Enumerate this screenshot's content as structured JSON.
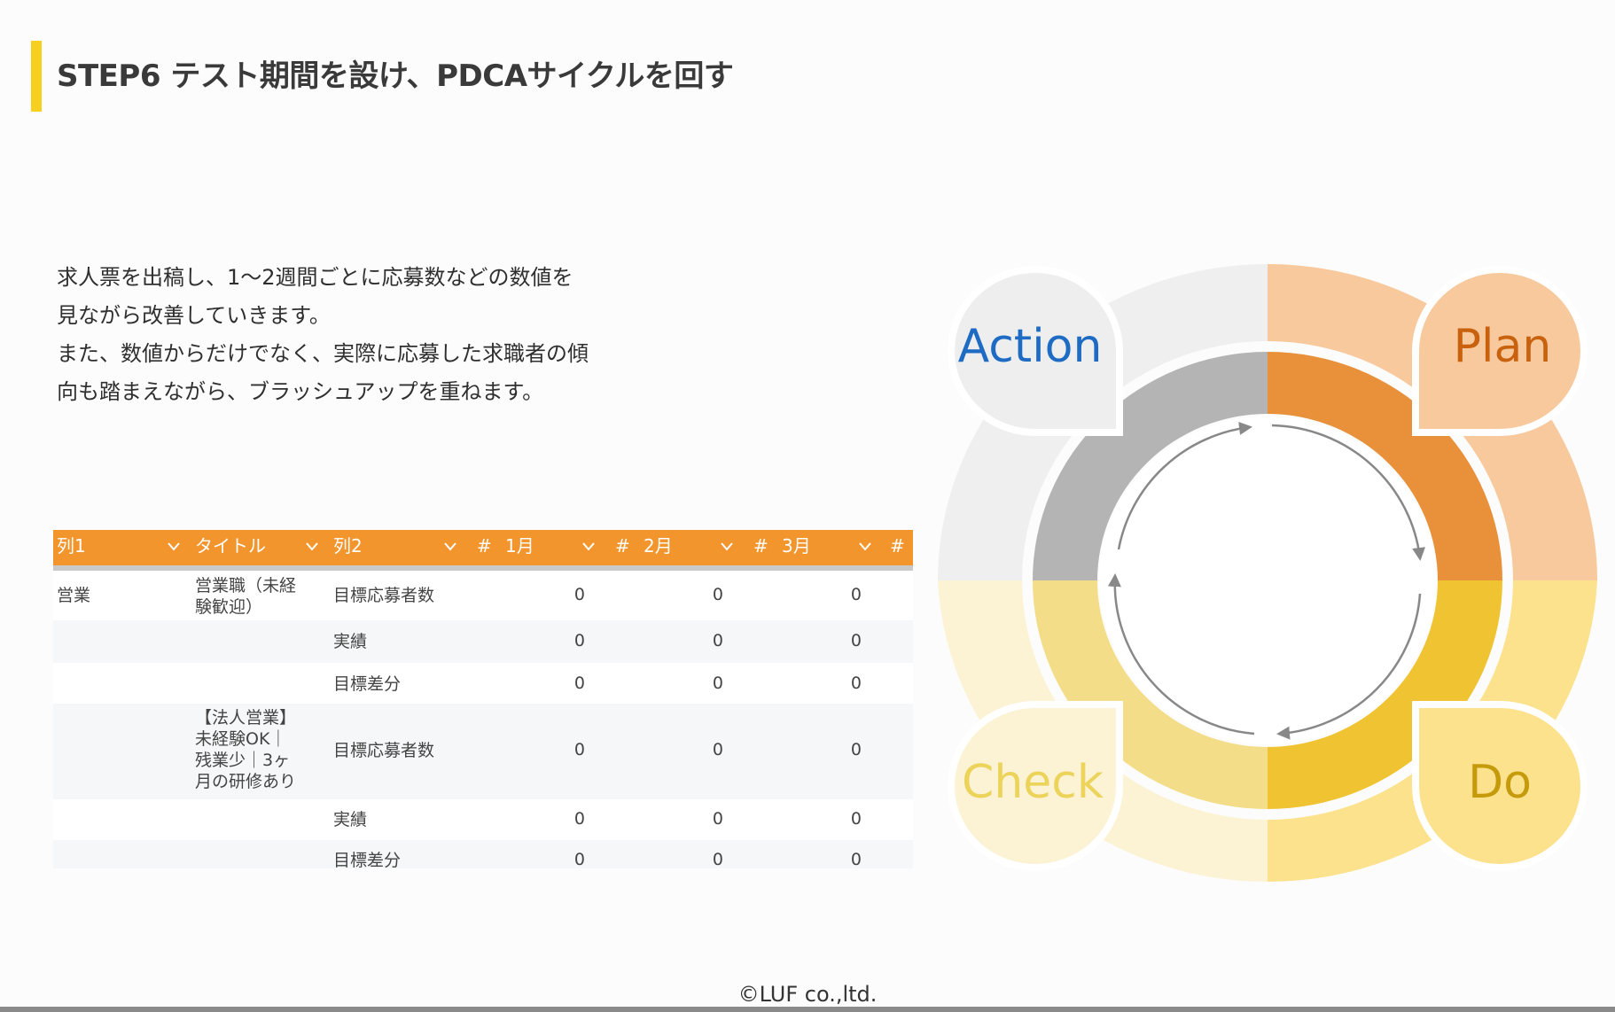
{
  "title": "STEP6 テスト期間を設け、PDCAサイクルを回す",
  "description": [
    "求人票を出稿し、1〜2週間ごとに応募数などの数値を",
    "見ながら改善していきます。",
    "また、数値からだけでなく、実際に応募した求職者の傾",
    "向も踏まえながら、ブラッシュアップを重ねます。"
  ],
  "table": {
    "headers": {
      "col1": "列1",
      "title": "タイトル",
      "col2": "列2",
      "hash": "#",
      "m1": "1月",
      "m2": "2月",
      "m3": "3月"
    },
    "rows": [
      {
        "col1": "営業",
        "title": "営業職（未経験歓迎）",
        "title_lines": [
          "営業職（未経",
          "験歓迎）"
        ],
        "col2": "目標応募者数",
        "m1": "0",
        "m2": "0",
        "m3": "0"
      },
      {
        "col1": "",
        "title": "",
        "title_lines": [],
        "col2": "実績",
        "m1": "0",
        "m2": "0",
        "m3": "0"
      },
      {
        "col1": "",
        "title": "",
        "title_lines": [],
        "col2": "目標差分",
        "m1": "0",
        "m2": "0",
        "m3": "0"
      },
      {
        "col1": "",
        "title": "【法人営業】未経験OK｜残業少｜3ヶ月の研修あり",
        "title_lines": [
          "【法人営業】",
          "未経験OK｜",
          "残業少｜3ヶ",
          "月の研修あり"
        ],
        "col2": "目標応募者数",
        "m1": "0",
        "m2": "0",
        "m3": "0"
      },
      {
        "col1": "",
        "title": "",
        "title_lines": [],
        "col2": "実績",
        "m1": "0",
        "m2": "0",
        "m3": "0"
      },
      {
        "col1": "",
        "title": "",
        "title_lines": [],
        "col2": "目標差分",
        "m1": "0",
        "m2": "0",
        "m3": "0"
      }
    ]
  },
  "pdca": {
    "action": "Action",
    "plan": "Plan",
    "do": "Do",
    "check": "Check",
    "colors": {
      "action_text": "#1e6bc4",
      "plan_text": "#c8620f",
      "do_text": "#c59a0b",
      "check_text": "#ecd35a"
    }
  },
  "footer": "©LUF co.,ltd."
}
